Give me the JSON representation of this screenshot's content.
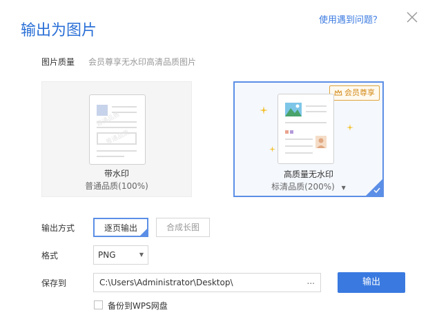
{
  "dialog": {
    "title": "输出为图片",
    "help_link": "使用遇到问题？"
  },
  "quality": {
    "label": "图片质量",
    "hint": "会员尊享无水印高清品质图片",
    "options": [
      {
        "title": "带水印",
        "subtitle": "普通品质(100%)",
        "watermark_text": "普通品质"
      },
      {
        "title": "高质量无水印",
        "subtitle": "标清品质(200%)",
        "badge": "会员尊享"
      }
    ]
  },
  "output_mode": {
    "label": "输出方式",
    "options": [
      "逐页输出",
      "合成长图"
    ],
    "selected_index": 0
  },
  "format": {
    "label": "格式",
    "value": "PNG"
  },
  "save_to": {
    "label": "保存到",
    "path": "C:\\Users\\Administrator\\Desktop\\",
    "browse": "..."
  },
  "export_button": "输出",
  "backup": {
    "label": "备份到WPS网盘",
    "checked": false
  },
  "colors": {
    "accent": "#3a7ae0",
    "selected_border": "#5b8ee6",
    "vip_gold": "#d38a17"
  }
}
